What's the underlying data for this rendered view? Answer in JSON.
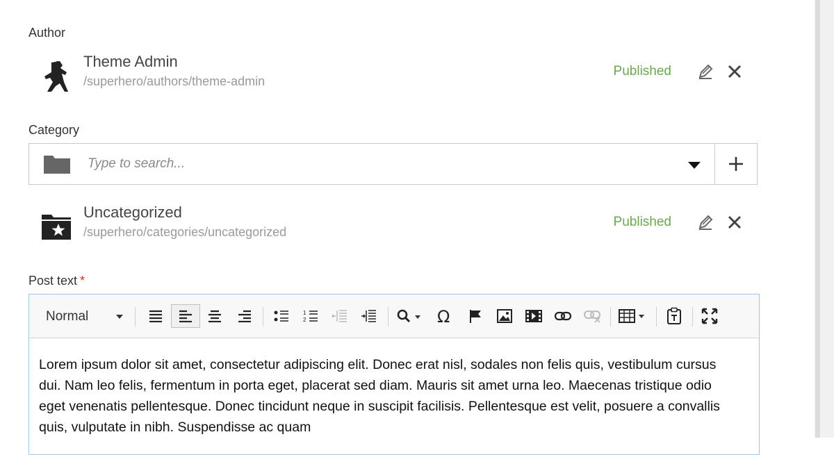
{
  "author": {
    "label": "Author",
    "item": {
      "title": "Theme Admin",
      "path": "/superhero/authors/theme-admin",
      "status": "Published"
    }
  },
  "category": {
    "label": "Category",
    "search": {
      "placeholder": "Type to search..."
    },
    "item": {
      "title": "Uncategorized",
      "path": "/superhero/categories/uncategorized",
      "status": "Published"
    }
  },
  "post_text": {
    "label": "Post text",
    "required_mark": "*",
    "format_value": "Normal",
    "content": "Lorem ipsum dolor sit amet, consectetur adipiscing elit. Donec erat nisl, sodales non felis quis, vestibulum cursus dui. Nam leo felis, fermentum in porta eget, placerat sed diam. Mauris sit amet urna leo. Maecenas tristique odio eget venenatis pellentesque. Donec tincidunt neque in suscipit facilisis. Pellentesque est velit, posuere a convallis quis, vulputate in nibh. Suspendisse ac quam"
  },
  "colors": {
    "published": "#6aa84f",
    "required": "#c0392b",
    "editor_border": "#9ec5ea"
  }
}
